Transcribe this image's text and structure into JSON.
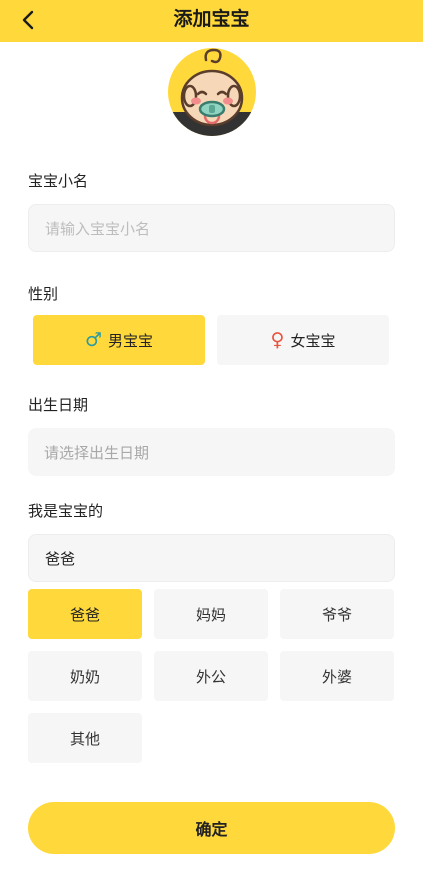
{
  "header": {
    "title": "添加宝宝",
    "back_icon": "chevron-left-icon"
  },
  "avatar": {
    "icon": "baby-avatar-icon"
  },
  "name_section": {
    "label": "宝宝小名",
    "placeholder": "请输入宝宝小名"
  },
  "gender_section": {
    "label": "性别",
    "options": [
      {
        "symbol": "♂",
        "label": "男宝宝",
        "selected": true,
        "symbol_color": "#2A9BA0"
      },
      {
        "symbol": "♀",
        "label": "女宝宝",
        "selected": false,
        "symbol_color": "#E8543E"
      }
    ]
  },
  "birth_section": {
    "label": "出生日期",
    "placeholder": "请选择出生日期"
  },
  "relation_section": {
    "label": "我是宝宝的",
    "value": "爸爸",
    "options": [
      {
        "label": "爸爸",
        "selected": true
      },
      {
        "label": "妈妈",
        "selected": false
      },
      {
        "label": "爷爷",
        "selected": false
      },
      {
        "label": "奶奶",
        "selected": false
      },
      {
        "label": "外公",
        "selected": false
      },
      {
        "label": "外婆",
        "selected": false
      },
      {
        "label": "其他",
        "selected": false
      }
    ]
  },
  "confirm_button": {
    "label": "确定"
  },
  "colors": {
    "accent": "#FFD93B",
    "field_bg": "#F6F6F6",
    "placeholder": "#BDBDBD"
  }
}
